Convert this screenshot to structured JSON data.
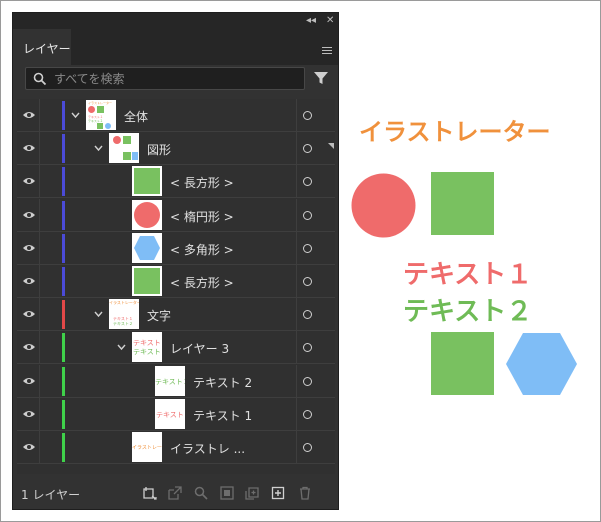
{
  "panel": {
    "tab_label": "レイヤー",
    "collapse_glyph": "◂◂",
    "close_glyph": "✕",
    "search": {
      "placeholder": "すべてを検索",
      "value": ""
    },
    "footer": {
      "layer_count": "1 レイヤー"
    }
  },
  "layers": [
    {
      "label": "全体",
      "depth": 0,
      "expanded": true,
      "color": "#4b4bd8",
      "thumb": "all"
    },
    {
      "label": "図形",
      "depth": 1,
      "expanded": true,
      "color": "#4b4bd8",
      "thumb": "shapes"
    },
    {
      "label": "< 長方形 >",
      "depth": 2,
      "expanded": null,
      "color": "#4b4bd8",
      "thumb": "rect"
    },
    {
      "label": "< 楕円形 >",
      "depth": 2,
      "expanded": null,
      "color": "#4b4bd8",
      "thumb": "ellipse"
    },
    {
      "label": "< 多角形 >",
      "depth": 2,
      "expanded": null,
      "color": "#4b4bd8",
      "thumb": "polygon"
    },
    {
      "label": "< 長方形 >",
      "depth": 2,
      "expanded": null,
      "color": "#4b4bd8",
      "thumb": "rect"
    },
    {
      "label": "文字",
      "depth": 1,
      "expanded": true,
      "color": "#e24848",
      "thumb": "text-all"
    },
    {
      "label": "レイヤー 3",
      "depth": 2,
      "expanded": true,
      "color": "#3fd14a",
      "thumb": "text-pair"
    },
    {
      "label": "テキスト 2",
      "depth": 3,
      "expanded": null,
      "color": "#3fd14a",
      "thumb": "text2"
    },
    {
      "label": "テキスト 1",
      "depth": 3,
      "expanded": null,
      "color": "#3fd14a",
      "thumb": "text1"
    },
    {
      "label": "イラストレ ...",
      "depth": 2,
      "expanded": null,
      "color": "#3fd14a",
      "thumb": "title"
    }
  ],
  "thumb_text": {
    "title": "イラストレーター",
    "text1": "テキスト１",
    "text2": "テキスト２"
  },
  "artboard": {
    "title": "イラストレーター",
    "text1": "テキスト１",
    "text2": "テキスト２",
    "colors": {
      "orange": "#f0913c",
      "red": "#ef6b6b",
      "green": "#79c160",
      "blue": "#7fbdf6"
    }
  }
}
